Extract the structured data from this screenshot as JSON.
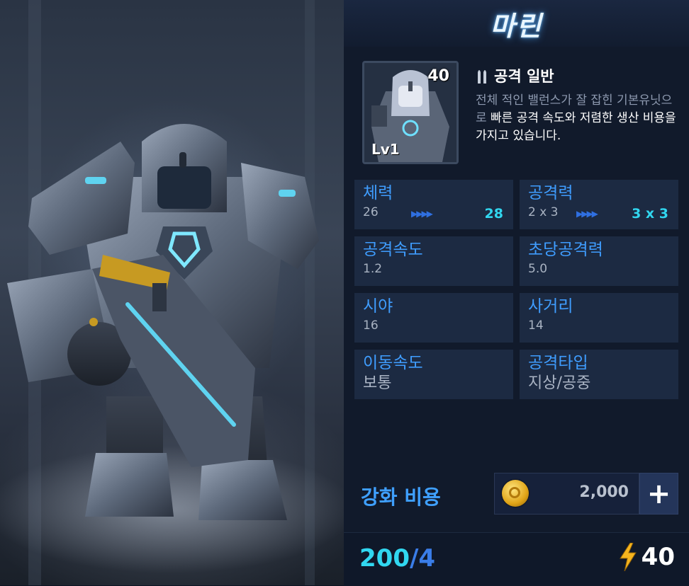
{
  "unit": {
    "name": "마린",
    "cost": "40",
    "level": "Lv1",
    "attack_type_label": "공격 일반",
    "description_plain": "전체 적인 밸런스가 잘 잡힌 기본유닛으로 ",
    "description_highlight": "빠른 공격 속도와 저렴한 생산 비용을 가지고 있습니다."
  },
  "stats": [
    {
      "name": "체력",
      "value": "26",
      "next": "28"
    },
    {
      "name": "공격력",
      "value": "2 x 3",
      "next": "3 x 3"
    },
    {
      "name": "공격속도",
      "value": "1.2"
    },
    {
      "name": "초당공격력",
      "value": "5.0"
    },
    {
      "name": "시야",
      "value": "16"
    },
    {
      "name": "사거리",
      "value": "14"
    },
    {
      "name": "이동속도",
      "value": "보통"
    },
    {
      "name": "공격타입",
      "value": "지상/공중"
    }
  ],
  "upgrade": {
    "label": "강화 비용",
    "cost": "2,000",
    "plus": "+"
  },
  "footer": {
    "count_current": "200",
    "count_slash": "/",
    "count_max": "4",
    "energy": "40"
  },
  "colors": {
    "accent_blue": "#3f9dff",
    "cyan": "#31d7f0",
    "panel_bg": "#111a2b",
    "stat_bg": "#1c2a42",
    "gold": "#e0a417"
  },
  "icons": {
    "bullet": "bullet-icon",
    "coin": "gold-coin-icon",
    "energy": "lightning-icon",
    "plus": "plus-icon",
    "upgrade_arrows": "arrow-right-icon"
  }
}
